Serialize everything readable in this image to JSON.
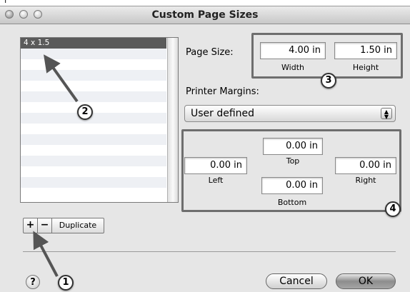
{
  "top_strip_text": "Γ",
  "window": {
    "title": "Custom Page Sizes"
  },
  "size_list": {
    "items": [
      "4 x 1.5"
    ],
    "selected_index": 0
  },
  "list_controls": {
    "add_label": "+",
    "remove_label": "−",
    "duplicate_label": "Duplicate"
  },
  "page_size": {
    "label": "Page Size:",
    "width_value": "4.00 in",
    "height_value": "1.50 in",
    "width_caption": "Width",
    "height_caption": "Height"
  },
  "margins": {
    "label": "Printer Margins:",
    "popup_value": "User defined",
    "top_value": "0.00 in",
    "left_value": "0.00 in",
    "right_value": "0.00 in",
    "bottom_value": "0.00 in",
    "top_caption": "Top",
    "left_caption": "Left",
    "right_caption": "Right",
    "bottom_caption": "Bottom"
  },
  "buttons": {
    "help": "?",
    "cancel": "Cancel",
    "ok": "OK"
  },
  "callouts": [
    "1",
    "2",
    "3",
    "4"
  ],
  "colors": {
    "selection": "#5a5a5a",
    "callout_border": "#6e6e6e"
  }
}
